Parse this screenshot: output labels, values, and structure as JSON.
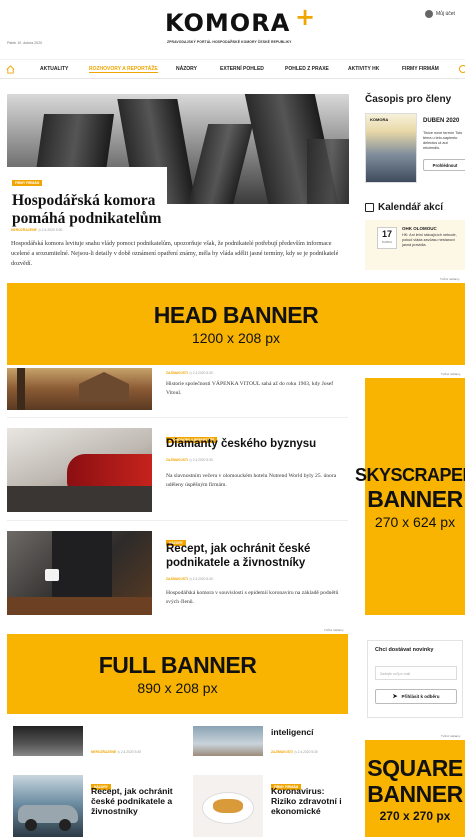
{
  "header": {
    "date": "Pátek 10. dubna 2020",
    "logo_text": "KOMORA",
    "logo_plus": "+",
    "tagline": "ZPRAVODAJSKÝ PORTÁL HOSPODÁŘSKÉ KOMORY ČESKÉ REPUBLIKY",
    "account_label": "Můj účet"
  },
  "nav": {
    "items": [
      "AKTUALITY",
      "ROZHOVORY A REPORTÁŽE",
      "NÁZORY",
      "EXTERNÍ POHLED",
      "POHLED Z PRAXE",
      "AKTIVITY HK",
      "FIRMY FIRMÁM"
    ],
    "active_index": 1
  },
  "hero": {
    "tag": "FIRMY FIRMÁM",
    "title": "Hospodářská komora pomáhá podnikatelům",
    "meta_category": "NEROZŘAZENÉ",
    "meta_date": "2.4.2020",
    "meta_time": "5:30",
    "perex": "Hospodářská komora levituje snahu vlády pomoci podnikatelům, upozorňuje však, že podnikatelé potřebují především informace ucelené a srozumitelné. Nejsou-li detaily v době oznámení opatření známy, měla by vláda sdělit jasné termíny, kdy se je podnikatelé dozvědí."
  },
  "sidebar": {
    "magazine_title": "Časopis pro členy",
    "magazine_cover_label": "KOMORA",
    "magazine_issue": "DUBEN 2020",
    "magazine_desc": "Tisíce nove termín Toto téma u leto-sapiento delectus ut aut reiciendis.",
    "magazine_button": "Prohlédnout",
    "calendar_title": "Kalendář akcí",
    "calendar_day": "17",
    "calendar_month": "DUBNA",
    "calendar_event": "OHK OLOMOUC",
    "calendar_desc": "HK: Ani letní stávajících nebude, pokud vláda zavčasu nestanoví jasná pravidla.",
    "newsletter_title": "Chci dostávat novinky",
    "newsletter_placeholder": "Zadejte svůj e-mail",
    "newsletter_button": "Přihlásit k odběru"
  },
  "ads": {
    "label": "Tvůrci reklamy",
    "head": {
      "line1": "HEAD BANNER",
      "line2": "1200 x 208 px"
    },
    "sky": {
      "line1": "SKYSCRAPER",
      "line2": "BANNER",
      "line3": "270 x 624 px"
    },
    "full": {
      "line1": "FULL BANNER",
      "line2": "890 x 208 px"
    },
    "square": {
      "line1": "SQUARE",
      "line2": "BANNER",
      "line3": "270 x 270 px"
    }
  },
  "articles": [
    {
      "tag": "",
      "meta_category": "ZAJÍMAVOSTI",
      "meta_date": "2.4.2020",
      "meta_time": "5:30",
      "title": "",
      "perex": "Historie společnosti VÁPENKA VITOUL sahá až do roku 1903, kdy Josef Vitoul."
    },
    {
      "tag": "ROZHOVORY A REPORTÁŽE",
      "meta_category": "ZAJÍMAVOSTI",
      "meta_date": "2.4.2020",
      "meta_time": "5:30",
      "title": "Diamanty českého byznysu",
      "perex": "Na slavnostním večeru v olomouckém hotelu Nutrend World byly 25. února uděleny úspěšným firmám."
    },
    {
      "tag": "NÁZORY",
      "meta_category": "ZAJÍMAVOSTI",
      "meta_date": "2.4.2020",
      "meta_time": "5:30",
      "title": "Recept, jak ochránit české podnikatele a živnostníky",
      "perex": "Hospodářská komora v souvislosti s epidemií koronaviru na základě podnětů svých členů."
    }
  ],
  "grid": [
    {
      "tag": "",
      "title": "",
      "meta_category": "NEROZŘAZENÉ",
      "meta_date": "2.4.2020",
      "meta_time": "5:30"
    },
    {
      "tag": "",
      "title": "inteligencí",
      "meta_category": "ZAJÍMAVOSTI",
      "meta_date": "2.4.2020",
      "meta_time": "5:30"
    },
    {
      "tag": "NÁZORY",
      "title": "Recept, jak ochránit české podnikatele a živnostníky",
      "meta_category": "",
      "meta_date": "",
      "meta_time": ""
    },
    {
      "tag": "FIRMY FIRMÁM",
      "title": "Koronavirus: Riziko zdravotní i ekonomické",
      "meta_category": "",
      "meta_date": "",
      "meta_time": ""
    }
  ]
}
